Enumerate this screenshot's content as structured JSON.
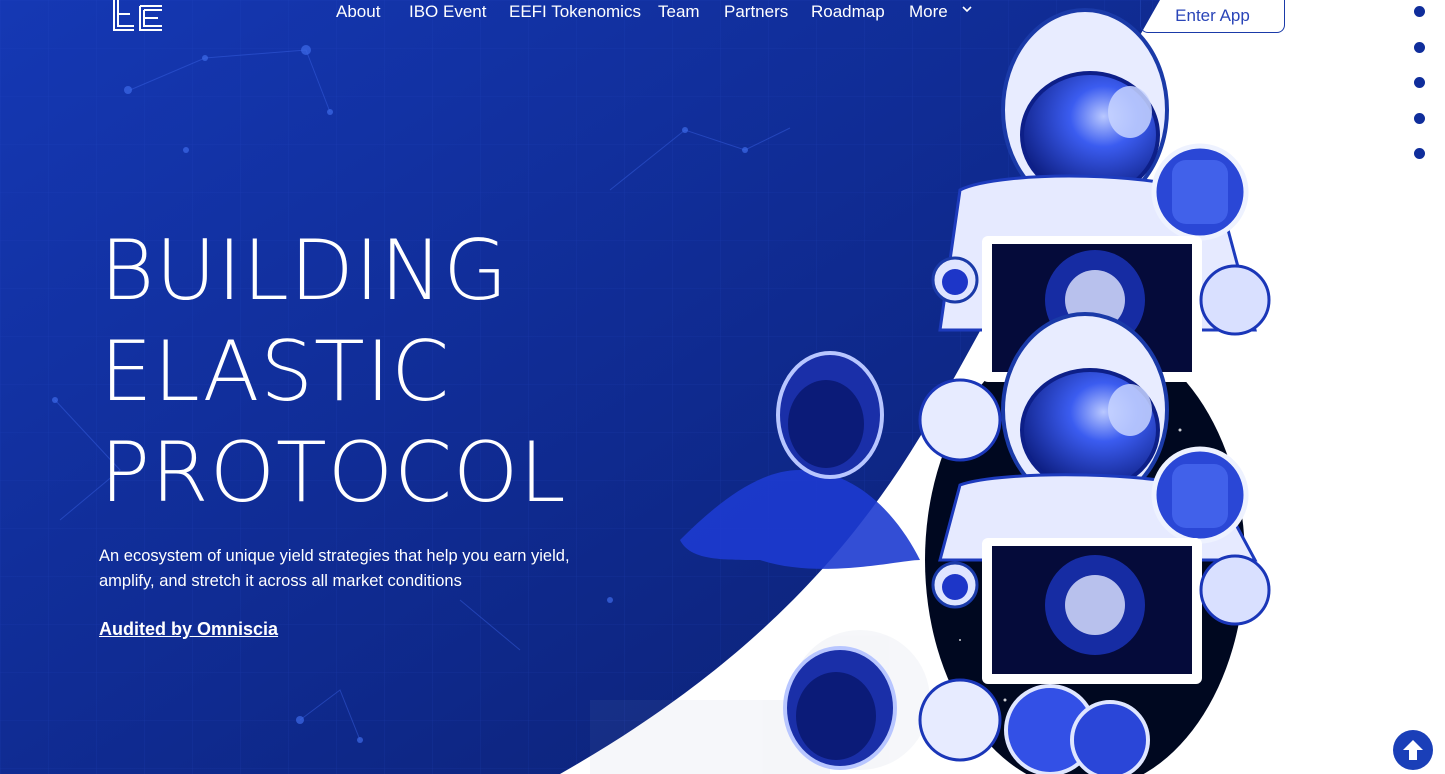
{
  "header": {
    "logo_alt": "EE",
    "nav": [
      {
        "label": "About"
      },
      {
        "label": "IBO Event"
      },
      {
        "label": "EEFI Tokenomics"
      },
      {
        "label": "Team"
      },
      {
        "label": "Partners"
      },
      {
        "label": "Roadmap"
      },
      {
        "label": "More"
      }
    ],
    "enter_app": "Enter App"
  },
  "hero": {
    "title_lines": [
      "BUILDING",
      "ELASTIC",
      "PROTOCOL"
    ],
    "description": "An ecosystem of unique yield strategies that help you earn yield, amplify, and stretch it across all market conditions",
    "audit_link": "Audited by Omniscia"
  },
  "side_nav": {
    "dot_count": 5,
    "active_index": 0
  },
  "colors": {
    "hero_blue_dark": "#0b1f6e",
    "hero_blue": "#1436b0",
    "accent": "#0f2d9b",
    "white": "#ffffff"
  },
  "icons": {
    "scroll_top": "arrow-up-icon",
    "more_chevron": "chevron-down-icon"
  }
}
